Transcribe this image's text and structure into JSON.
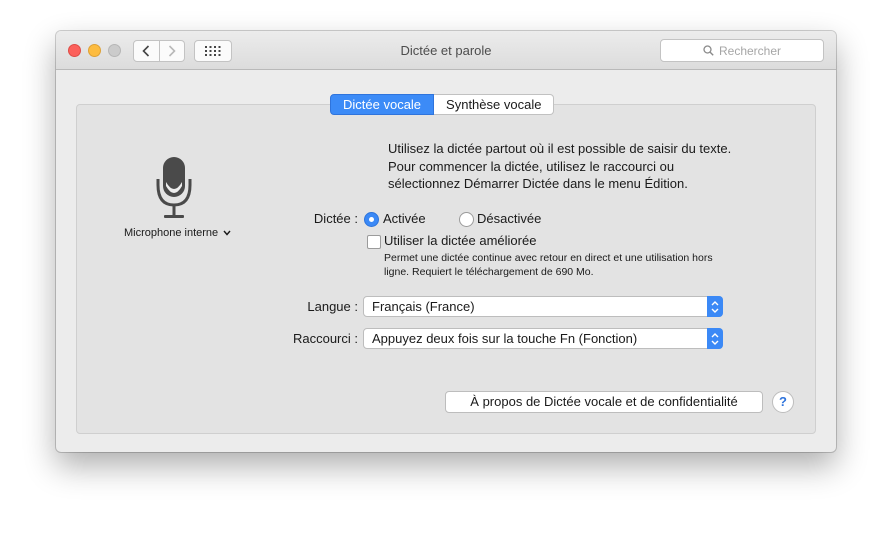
{
  "window": {
    "title": "Dictée et parole",
    "search_placeholder": "Rechercher"
  },
  "tabs": [
    {
      "label": "Dictée vocale",
      "active": true
    },
    {
      "label": "Synthèse vocale",
      "active": false
    }
  ],
  "microphone": {
    "label": "Microphone interne"
  },
  "description": {
    "line1": "Utilisez la dictée partout où il est possible de saisir du texte.",
    "line2": "Pour commencer la dictée, utilisez le raccourci ou",
    "line3": "sélectionnez Démarrer Dictée dans le menu Édition."
  },
  "dictation": {
    "label": "Dictée :",
    "on_label": "Activée",
    "off_label": "Désactivée",
    "selected": "Activée"
  },
  "enhanced": {
    "label": "Utiliser la dictée améliorée",
    "checked": false,
    "note_line1": "Permet une dictée continue avec retour en direct et une utilisation hors",
    "note_line2": "ligne. Requiert le téléchargement de 690 Mo."
  },
  "language": {
    "label": "Langue :",
    "value": "Français (France)"
  },
  "shortcut": {
    "label": "Raccourci :",
    "value": "Appuyez deux fois sur la touche Fn (Fonction)"
  },
  "about_button": "À propos de Dictée vocale et de confidentialité",
  "help_button": "?",
  "colors": {
    "accent": "#3b89f6",
    "close": "#fc605b",
    "minimize": "#fdbc40"
  }
}
